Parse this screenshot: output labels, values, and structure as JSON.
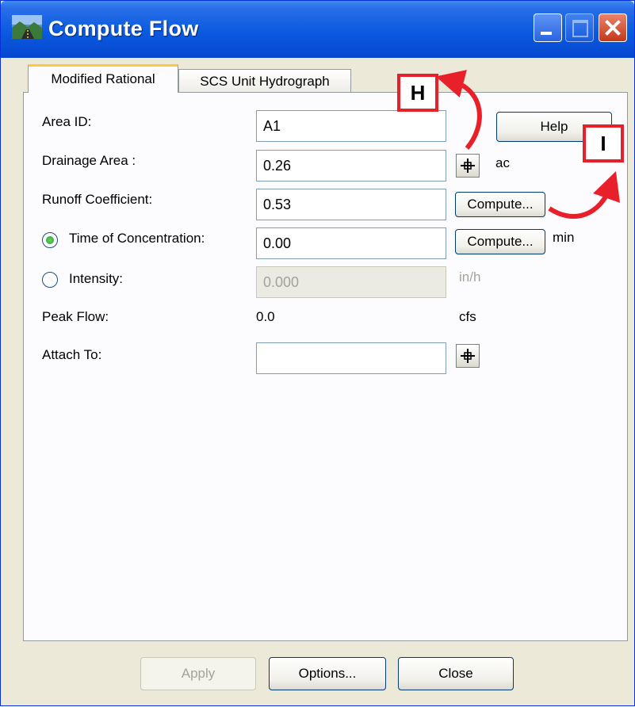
{
  "window": {
    "title": "Compute Flow",
    "icon": "landscape-app-icon",
    "controls": [
      "minimize-icon",
      "maximize-icon",
      "close-icon"
    ]
  },
  "tabs": [
    {
      "label": "Modified Rational",
      "active": true
    },
    {
      "label": "SCS Unit Hydrograph",
      "active": false
    }
  ],
  "form": {
    "area_id": {
      "label": "Area ID:",
      "value": "A1"
    },
    "drainage_area": {
      "label": "Drainage Area :",
      "value": "0.26",
      "unit": "ac"
    },
    "runoff_coefficient": {
      "label": "Runoff Coefficient:",
      "value": "0.53",
      "button": "Compute..."
    },
    "time_of_concentration": {
      "label": "Time of Concentration:",
      "value": "0.00",
      "button": "Compute...",
      "unit": "min",
      "selected": true
    },
    "intensity": {
      "label": "Intensity:",
      "value": "0.000",
      "unit": "in/h",
      "selected": false
    },
    "peak_flow": {
      "label": "Peak Flow:",
      "value": "0.0",
      "unit": "cfs"
    },
    "attach_to": {
      "label": "Attach To:",
      "value": ""
    },
    "help_button": "Help"
  },
  "footer": {
    "apply": "Apply",
    "options": "Options...",
    "close": "Close"
  },
  "callouts": [
    {
      "letter": "H",
      "border_color": "#e8202a"
    },
    {
      "letter": "I",
      "border_color": "#e8202a"
    }
  ],
  "colors": {
    "titlebar": "#0a5ae0",
    "callout_red": "#e8202a",
    "radio_green": "#21a121",
    "tab_highlight": "#ffc83c"
  }
}
